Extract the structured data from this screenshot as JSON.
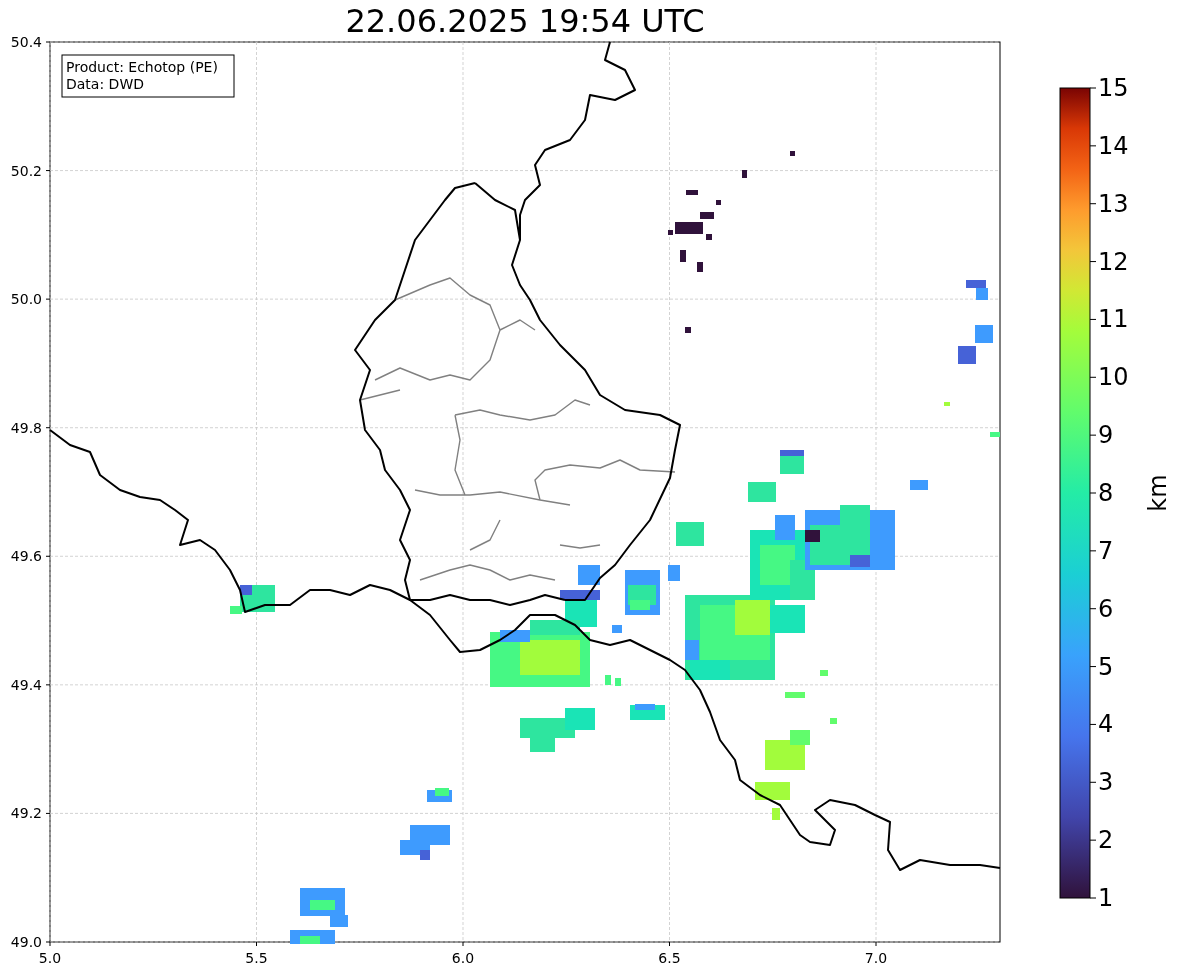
{
  "title": "22.06.2025 19:54 UTC",
  "info_box": {
    "lines": [
      "Product: Echotop (PE)",
      "Data: DWD"
    ]
  },
  "x_ticks": [
    "5.0",
    "5.5",
    "6.0",
    "6.5",
    "7.0"
  ],
  "y_ticks": [
    "50.4",
    "50.2",
    "50.0",
    "49.8",
    "49.6",
    "49.4",
    "49.2",
    "49.0"
  ],
  "colorbar": {
    "label": "km",
    "ticks": [
      "15",
      "14",
      "13",
      "12",
      "11",
      "10",
      "9",
      "8",
      "7",
      "6",
      "5",
      "4",
      "3",
      "2",
      "1"
    ]
  }
}
